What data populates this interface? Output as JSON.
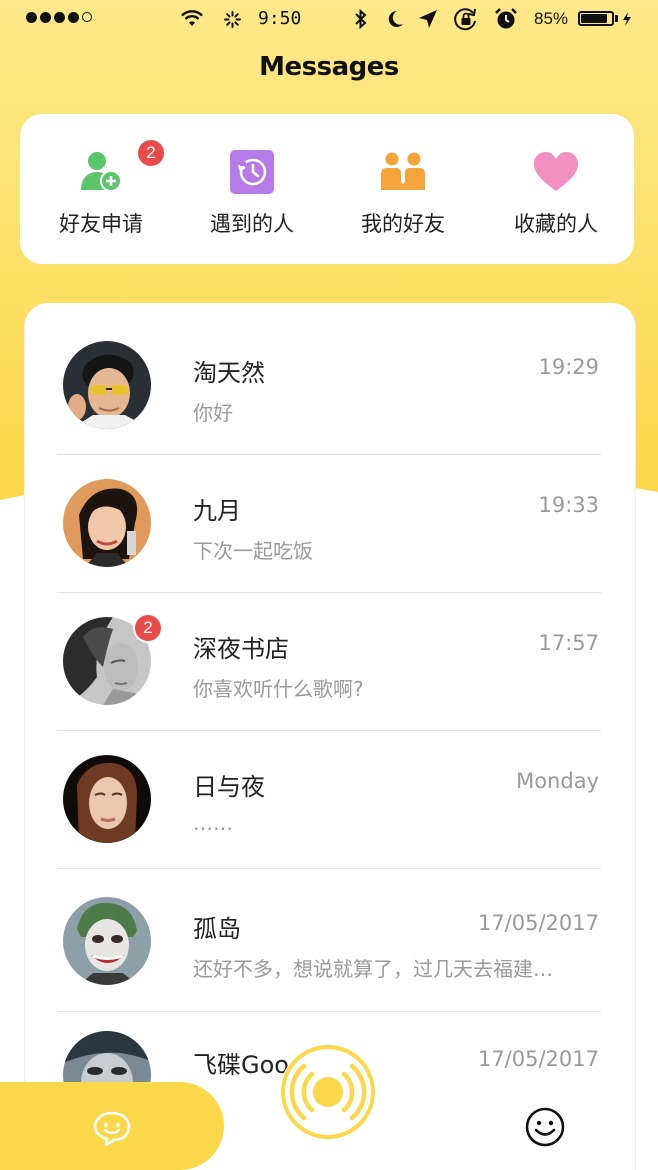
{
  "status_bar": {
    "time": "9:50",
    "battery_percent": "85%",
    "battery_level": 0.85,
    "signal_bars_filled": 4,
    "signal_bars_total": 5
  },
  "header": {
    "title": "Messages"
  },
  "quick_actions": [
    {
      "label": "好友申请",
      "icon": "friend-request-icon",
      "badge": "2",
      "color": "#5cc46b"
    },
    {
      "label": "遇到的人",
      "icon": "history-clock-icon",
      "color": "#b57be6"
    },
    {
      "label": "我的好友",
      "icon": "friends-icon",
      "color": "#f5a43b"
    },
    {
      "label": "收藏的人",
      "icon": "heart-icon",
      "color": "#f08fc0"
    }
  ],
  "conversations": [
    {
      "name": "淘天然",
      "time": "19:29",
      "preview": "你好"
    },
    {
      "name": "九月",
      "time": "19:33",
      "preview": "下次一起吃饭"
    },
    {
      "name": "深夜书店",
      "time": "17:57",
      "preview": "你喜欢听什么歌啊?",
      "badge": "2"
    },
    {
      "name": "日与夜",
      "time": "Monday",
      "preview": "……"
    },
    {
      "name": "孤岛",
      "time": "17/05/2017",
      "preview": "还好不多，想说就算了，过几天去福建…"
    },
    {
      "name": "飞碟Good",
      "time": "17/05/2017",
      "preview": ""
    }
  ],
  "tab_bar": {
    "items": [
      {
        "name": "messages",
        "icon": "chat-bubble-smile-icon",
        "active": true
      },
      {
        "name": "radar",
        "icon": "broadcast-icon"
      },
      {
        "name": "profile",
        "icon": "smiley-face-icon"
      }
    ]
  },
  "colors": {
    "accent_yellow": "#fbd84a",
    "badge_red": "#ea4a4a",
    "text_primary": "#222222",
    "text_secondary": "#9a9a9a"
  }
}
